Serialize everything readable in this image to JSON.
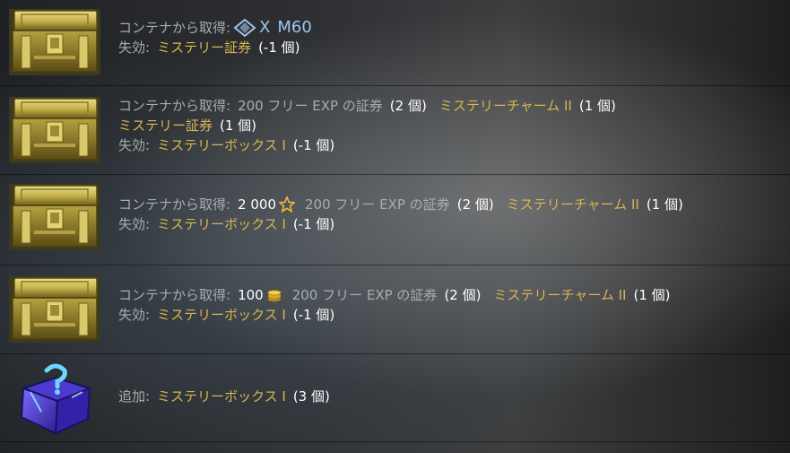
{
  "rows": [
    {
      "icon": "gold-container-icon",
      "line1": {
        "label": "コンテナから取得:",
        "vehicle_tier": "X",
        "vehicle_name": "M60"
      },
      "line2": {
        "label": "失効:",
        "item": "ミステリー証券",
        "count": "(-1 個)"
      }
    },
    {
      "icon": "gold-container-icon",
      "line1": {
        "label": "コンテナから取得:",
        "item1": "200 フリー EXP の証券",
        "count1": "(2 個)",
        "item2": "ミステリーチャーム II",
        "count2": "(1 個)"
      },
      "line2": {
        "item": "ミステリー証券",
        "count": "(1 個)"
      },
      "line3": {
        "label": "失効:",
        "item": "ミステリーボックス I",
        "count": "(-1 個)"
      }
    },
    {
      "icon": "gold-container-icon",
      "line1": {
        "label": "コンテナから取得:",
        "amount": "2 000",
        "item1": "200 フリー EXP の証券",
        "count1": "(2 個)",
        "item2": "ミステリーチャーム II",
        "count2": "(1 個)"
      },
      "line2": {
        "label": "失効:",
        "item": "ミステリーボックス I",
        "count": "(-1 個)"
      }
    },
    {
      "icon": "gold-container-icon",
      "line1": {
        "label": "コンテナから取得:",
        "amount": "100",
        "item1": "200 フリー EXP の証券",
        "count1": "(2 個)",
        "item2": "ミステリーチャーム II",
        "count2": "(1 個)"
      },
      "line2": {
        "label": "失効:",
        "item": "ミステリーボックス I",
        "count": "(-1 個)"
      }
    },
    {
      "icon": "mystery-box-icon",
      "line1": {
        "label": "追加:",
        "item": "ミステリーボックス I",
        "count": "(3 個)"
      }
    }
  ],
  "colors": {
    "gold": "#d9b64e",
    "gray": "#a8acaf",
    "white": "#ffffff",
    "blue": "#9ec6ea"
  }
}
